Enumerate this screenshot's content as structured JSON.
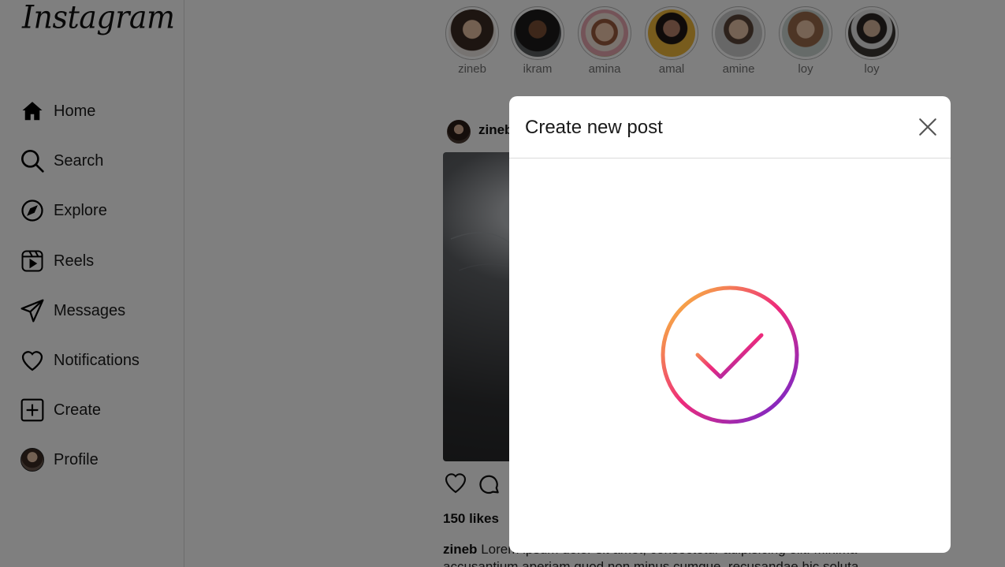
{
  "sidebar": {
    "logo": "Instagram",
    "items": [
      {
        "label": "Home",
        "icon": "home-icon"
      },
      {
        "label": "Search",
        "icon": "search-icon"
      },
      {
        "label": "Explore",
        "icon": "compass-icon"
      },
      {
        "label": "Reels",
        "icon": "reels-icon"
      },
      {
        "label": "Messages",
        "icon": "paper-plane-icon"
      },
      {
        "label": "Notifications",
        "icon": "heart-icon"
      },
      {
        "label": "Create",
        "icon": "plus-square-icon"
      },
      {
        "label": "Profile",
        "icon": "avatar"
      }
    ]
  },
  "stories": [
    {
      "name": "zineb"
    },
    {
      "name": "ikram"
    },
    {
      "name": "amina"
    },
    {
      "name": "amal"
    },
    {
      "name": "amine"
    },
    {
      "name": "loy"
    },
    {
      "name": "loy"
    }
  ],
  "post": {
    "username": "zineb",
    "likes": "150 likes",
    "caption_user": "zineb",
    "caption_text": "Lorem ipsum dolor sit amet, consectetur adipisicing elit. Minima accusantium aperiam quod non minus cumque, recusandae hic soluta."
  },
  "modal": {
    "title": "Create new post",
    "close_icon": "close-icon",
    "status_icon": "success-check-icon",
    "gradient": [
      "#f9ce34",
      "#ee2a7b",
      "#6228d7"
    ]
  },
  "colors": {
    "overlay": "rgba(0,0,0,0.5)",
    "border": "#dbdbdb",
    "muted_text": "#737373"
  }
}
